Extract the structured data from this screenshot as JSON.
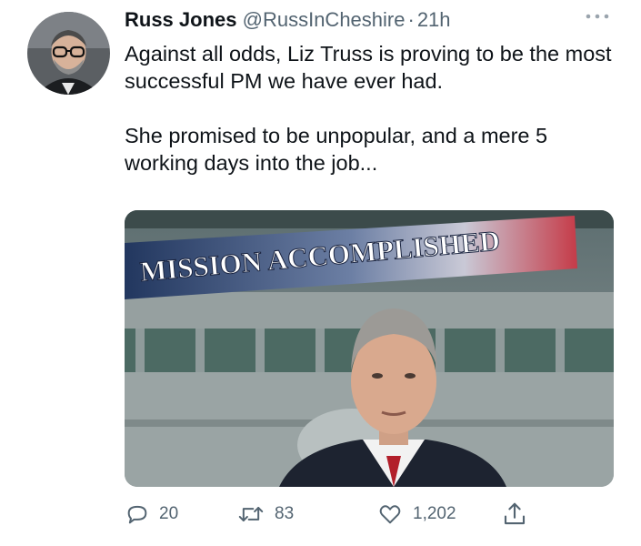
{
  "tweet": {
    "display_name": "Russ Jones",
    "handle": "@RussInCheshire",
    "separator": "·",
    "time": "21h",
    "text_paragraphs": [
      "Against all odds, Liz Truss is proving to be the most successful PM we have ever had.",
      "She promised to be unpopular, and a mere 5 working days into the job..."
    ],
    "media": {
      "banner_text": "MISSION ACCOMPLISHED"
    },
    "actions": {
      "reply_count": "20",
      "retweet_count": "83",
      "like_count": "1,202"
    },
    "icons": {
      "more": "more-icon",
      "reply": "reply-icon",
      "retweet": "retweet-icon",
      "like": "heart-icon",
      "share": "share-icon"
    }
  }
}
